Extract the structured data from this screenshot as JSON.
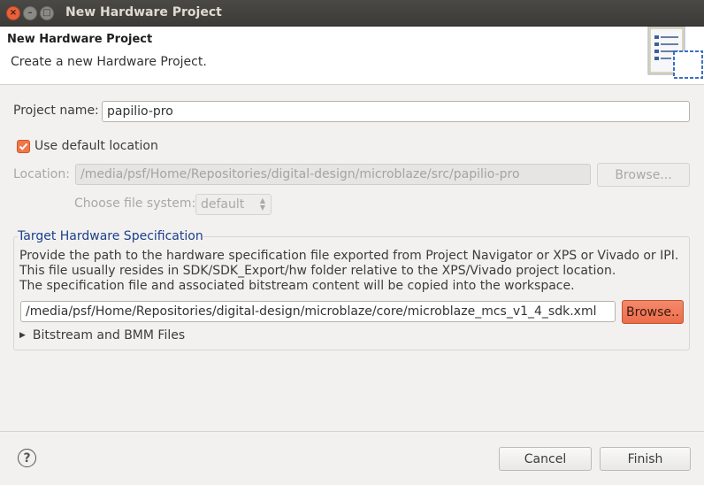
{
  "window": {
    "title": "New Hardware Project",
    "close_glyph": "×",
    "min_glyph": "–",
    "max_glyph": "□"
  },
  "header": {
    "title": "New Hardware Project",
    "description": "Create a new Hardware Project.",
    "icon": "wizard-page-icon"
  },
  "form": {
    "project_name_label": "Project name:",
    "project_name_value": "papilio-pro",
    "use_default_label": "Use default location",
    "use_default_checked": true,
    "location_label": "Location:",
    "location_value": "/media/psf/Home/Repositories/digital-design/microblaze/src/papilio-pro",
    "location_browse_label": "Browse...",
    "file_system_label": "Choose file system:",
    "file_system_value": "default"
  },
  "target": {
    "group_title": "Target Hardware Specification",
    "description_lines": [
      "Provide the path to the hardware specification file exported from Project Navigator or XPS or Vivado or IPI.",
      "This file usually resides in SDK/SDK_Export/hw folder relative to the XPS/Vivado project location.",
      "The specification file and associated bitstream content will be copied into the workspace."
    ],
    "spec_path_value": "/media/psf/Home/Repositories/digital-design/microblaze/core/microblaze_mcs_v1_4_sdk.xml",
    "browse_label": "Browse..",
    "bitstream_label": "Bitstream and BMM Files"
  },
  "footer": {
    "help_glyph": "?",
    "cancel_label": "Cancel",
    "finish_label": "Finish"
  },
  "colors": {
    "accent": "#f07746",
    "group_title": "#1b3f8a"
  }
}
